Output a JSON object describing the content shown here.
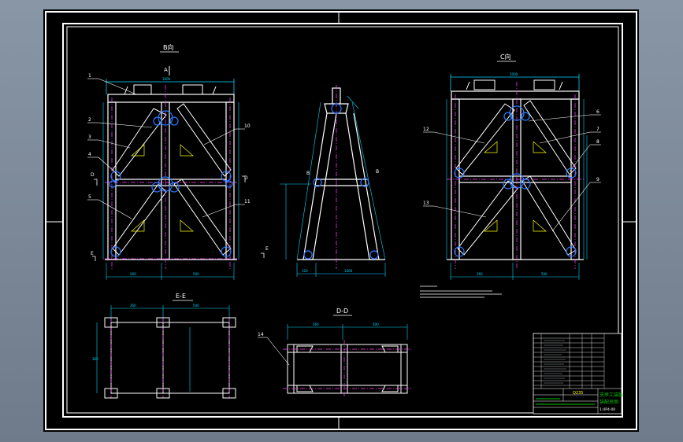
{
  "drawing": {
    "views": {
      "b": {
        "label": "B向",
        "arrow_mark": "A"
      },
      "side": {
        "section_marks": [
          "B",
          "B"
        ]
      },
      "c": {
        "label": "C向"
      },
      "ee": {
        "label": "E-E"
      },
      "dd": {
        "label": "D-D"
      }
    },
    "section_marks": {
      "d_left": "D",
      "d_right": "D",
      "e_left": "E",
      "e_right": "E"
    },
    "callouts_left": [
      "1",
      "2",
      "3",
      "4",
      "5"
    ],
    "callouts_right_b": [
      "10",
      "11"
    ],
    "callouts_c_left": [
      "12",
      "13"
    ],
    "callouts_c_right": [
      "6",
      "7",
      "8",
      "9"
    ],
    "callout_dd": "14",
    "dimensions": {
      "b_top": "1000",
      "b_bottom_a": "260",
      "b_bottom_b": "500",
      "c_top": "1000",
      "c_bottom_a": "260",
      "c_bottom_b": "500",
      "side_bottom_a": "120",
      "side_bottom_b": "1000",
      "ee_top": "260",
      "ee_right": "500",
      "ee_side": "360",
      "dd_top_a": "260",
      "dd_top_b": "500"
    },
    "title_block": {
      "title_line1": "支承工装胎",
      "title_line2": "装配总图",
      "drawing_no": "1:4P4-00",
      "material_label": "Q235"
    }
  },
  "colors": {
    "background": "#000000",
    "frame": "#ffffff",
    "outline": "#ffffff",
    "centerline": "#ff44ff",
    "dimension": "#00d8ff",
    "weld": "#2c7bff",
    "leader": "#ffffff",
    "title_text": "#ffff00",
    "title_green": "#00c000"
  }
}
